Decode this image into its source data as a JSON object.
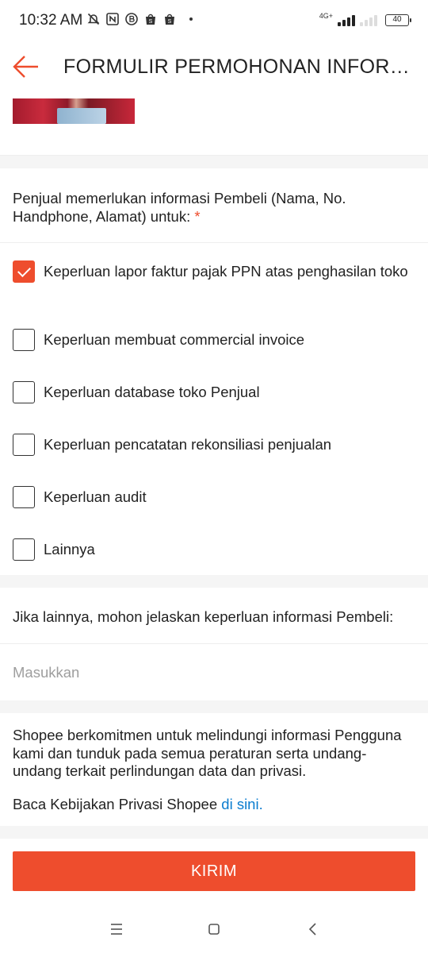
{
  "status_bar": {
    "time": "10:32 AM",
    "network_type": "4G+",
    "battery_level": "40",
    "icons": [
      "notifications-muted-icon",
      "nfc-icon",
      "b-badge-icon",
      "shopee-app-icon",
      "shopee-app-icon-2",
      "dot-icon"
    ]
  },
  "header": {
    "title": "FORMULIR PERMOHONAN INFORMASI PEMBELI",
    "back_icon": "arrow-left-icon"
  },
  "question": {
    "text": "Penjual memerlukan informasi Pembeli (Nama, No. Handphone, Alamat) untuk:",
    "required_mark": "*",
    "options": [
      {
        "label": "Keperluan lapor faktur pajak PPN atas penghasilan toko",
        "checked": true
      },
      {
        "label": "Keperluan membuat commercial invoice",
        "checked": false
      },
      {
        "label": "Keperluan database toko Penjual",
        "checked": false
      },
      {
        "label": "Keperluan pencatatan rekonsiliasi penjualan",
        "checked": false
      },
      {
        "label": "Keperluan audit",
        "checked": false
      },
      {
        "label": "Lainnya",
        "checked": false
      }
    ]
  },
  "other_reason": {
    "label": "Jika lainnya, mohon jelaskan keperluan informasi Pembeli:",
    "placeholder": "Masukkan",
    "value": ""
  },
  "privacy": {
    "text": "Shopee berkomitmen untuk melindungi informasi Pengguna kami dan tunduk pada semua peraturan serta undang-undang terkait perlindungan data dan privasi.",
    "link_prefix": "Baca Kebijakan Privasi Shopee ",
    "link_text": "di sini."
  },
  "submit": {
    "label": "KIRIM"
  },
  "nav": {
    "icons": [
      "recent-apps-icon",
      "home-icon",
      "back-icon"
    ]
  },
  "colors": {
    "accent": "#ee4d2d",
    "link": "#0a7ccf",
    "background": "#f5f5f5"
  }
}
